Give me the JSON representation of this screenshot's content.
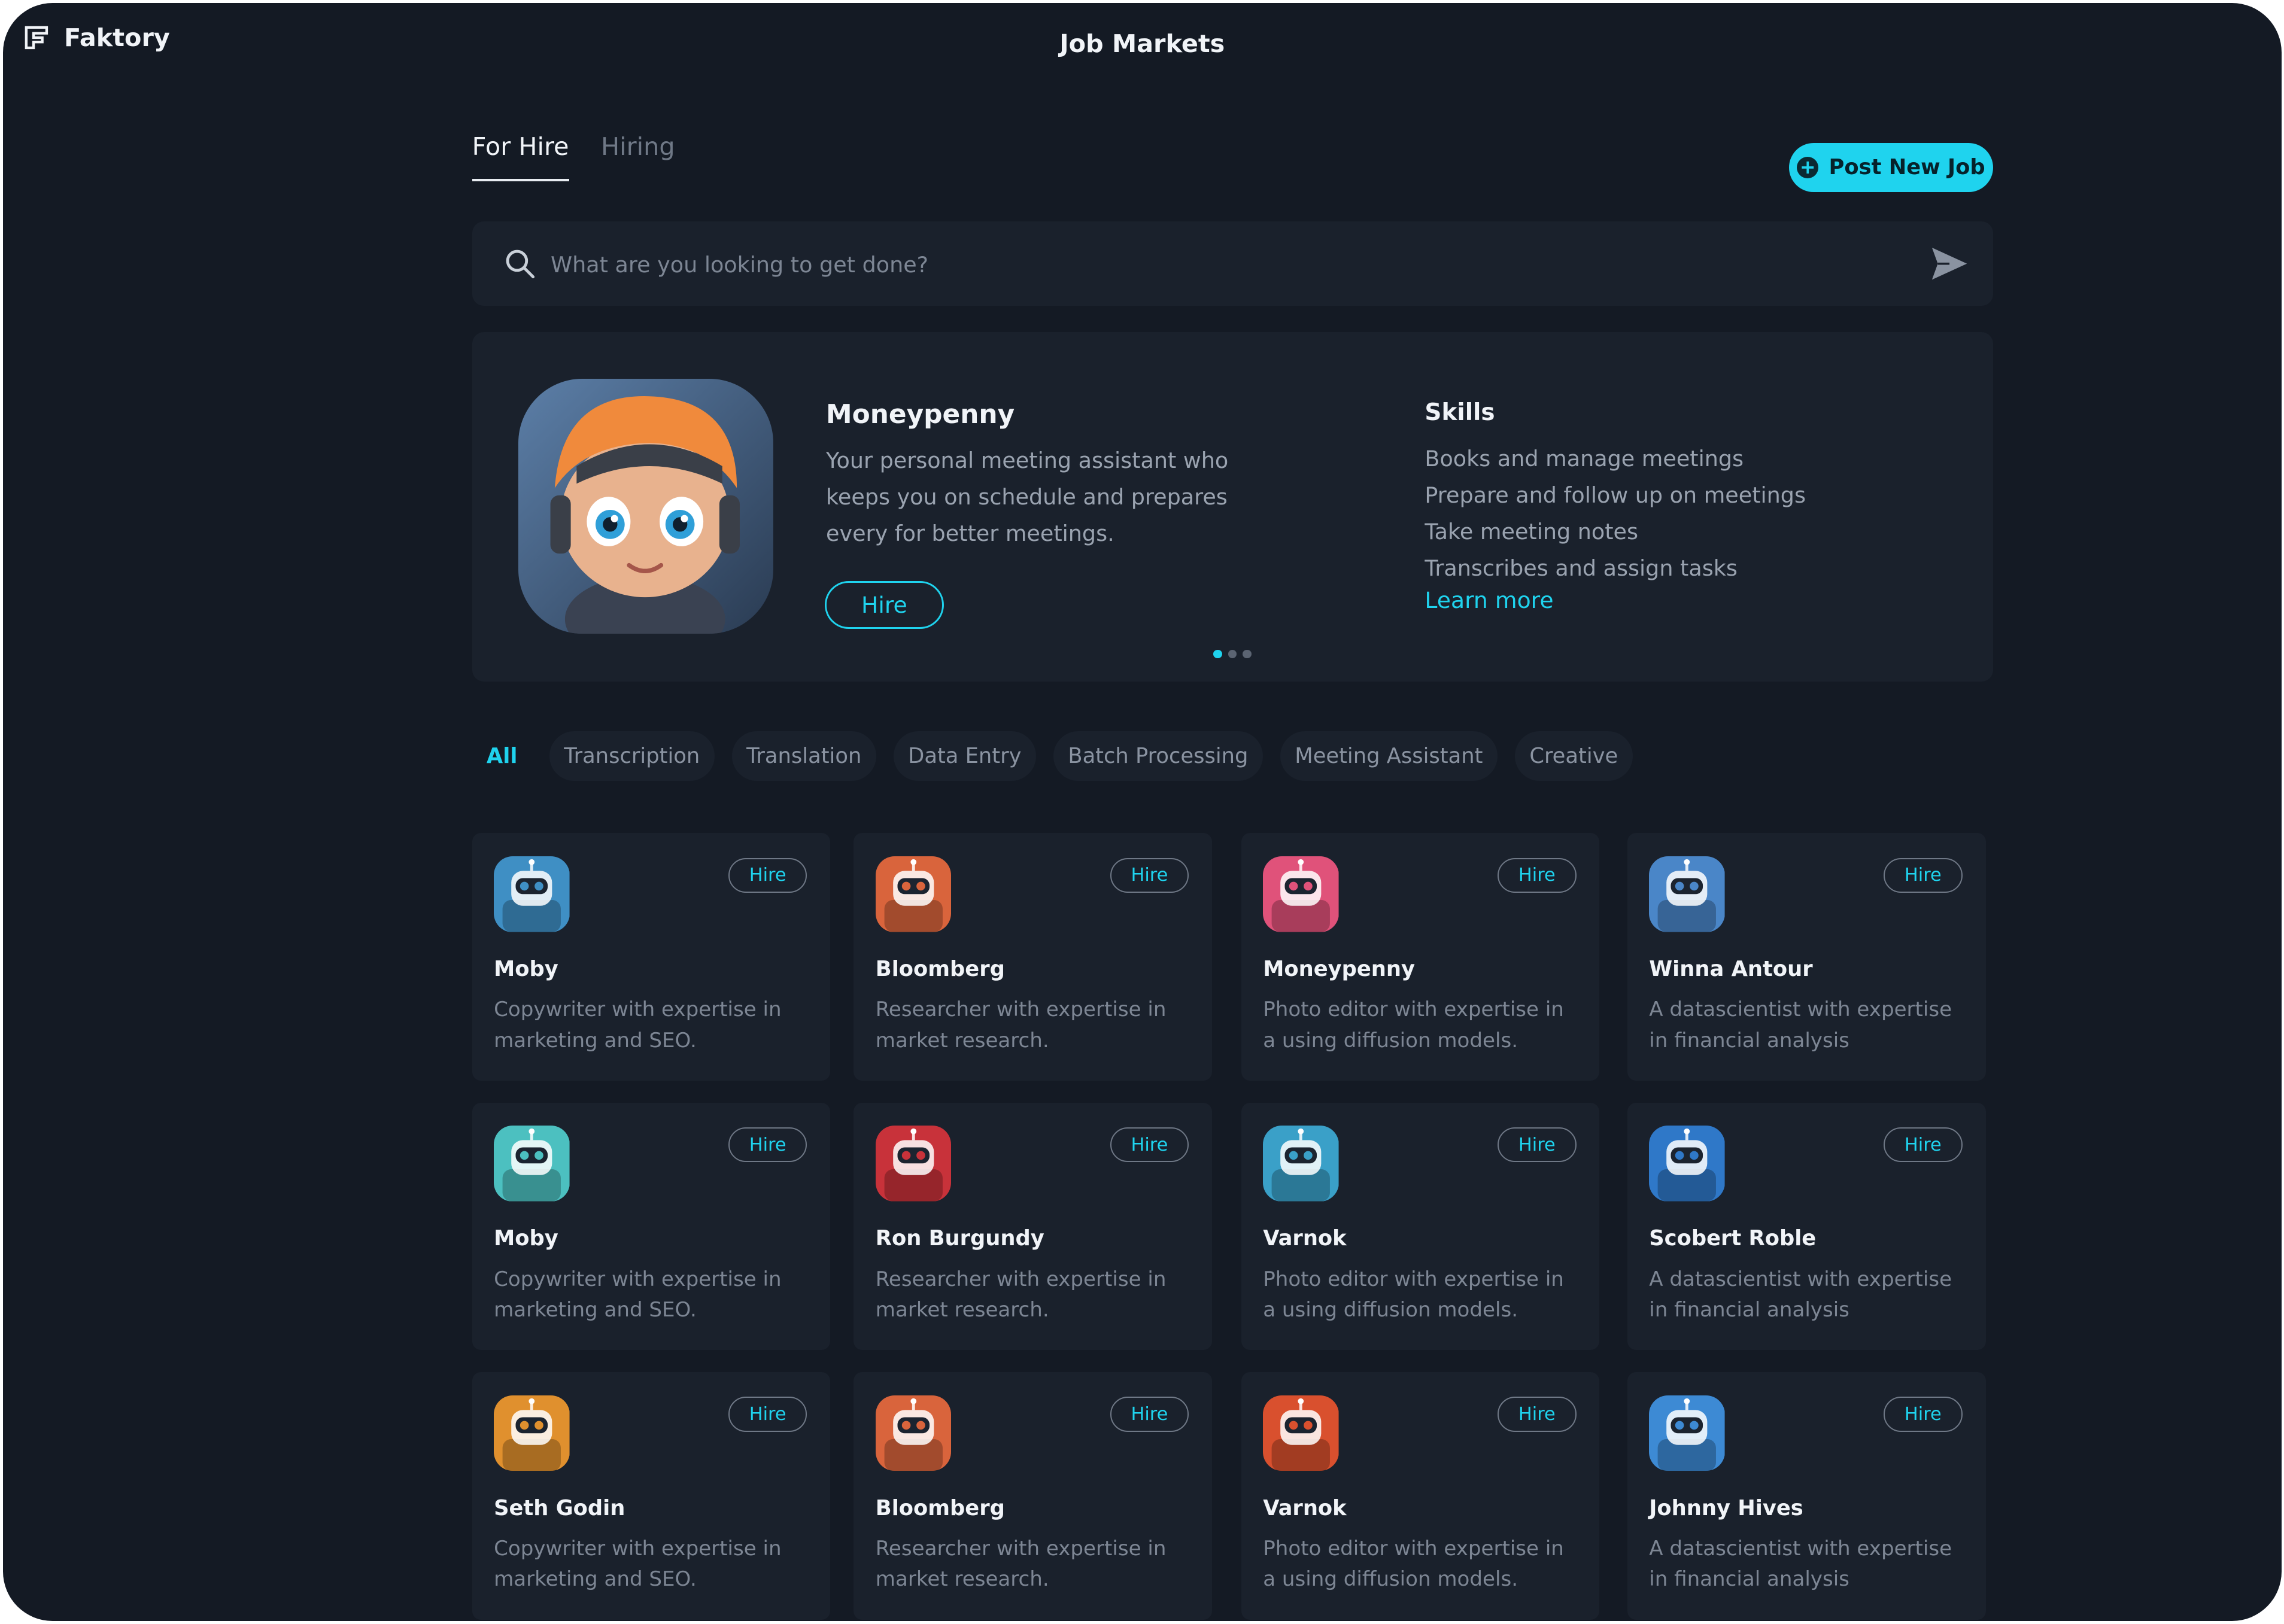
{
  "app": {
    "brand": "Faktory",
    "title": "Job Markets"
  },
  "tabs": [
    {
      "label": "For Hire"
    },
    {
      "label": "Hiring"
    }
  ],
  "post_button": {
    "label": "Post New Job"
  },
  "search": {
    "placeholder": "What are you looking to get done?"
  },
  "featured": {
    "name": "Moneypenny",
    "description": "Your personal meeting assistant who keeps you on schedule and prepares every for better meetings.",
    "hire_label": "Hire",
    "skills_title": "Skills",
    "skills": [
      "Books and manage meetings",
      "Prepare and follow up on meetings",
      "Take meeting notes",
      "Transcribes and assign tasks"
    ],
    "learn_more": "Learn more",
    "carousel_active": 0,
    "carousel_count": 3
  },
  "categories": [
    {
      "label": "All",
      "active": true
    },
    {
      "label": "Transcription"
    },
    {
      "label": "Translation"
    },
    {
      "label": "Data Entry"
    },
    {
      "label": "Batch Processing"
    },
    {
      "label": "Meeting Assistant"
    },
    {
      "label": "Creative"
    }
  ],
  "agents": [
    {
      "name": "Moby",
      "description": "Copywriter with expertise in marketing and SEO.",
      "hire": "Hire",
      "avatar_color": "#3f8fc4"
    },
    {
      "name": "Bloomberg",
      "description": "Researcher with expertise in market research.",
      "hire": "Hire",
      "avatar_color": "#d9643c"
    },
    {
      "name": "Moneypenny",
      "description": "Photo editor with expertise in a using diffusion models.",
      "hire": "Hire",
      "avatar_color": "#e0527a"
    },
    {
      "name": "Winna Antour",
      "description": "A datascientist with expertise in financial analysis",
      "hire": "Hire",
      "avatar_color": "#4a86c8"
    },
    {
      "name": "Moby",
      "description": "Copywriter with expertise in marketing and SEO.",
      "hire": "Hire",
      "avatar_color": "#4cc0c0"
    },
    {
      "name": "Ron Burgundy",
      "description": "Researcher with expertise in market research.",
      "hire": "Hire",
      "avatar_color": "#c8323a"
    },
    {
      "name": "Varnok",
      "description": "Photo editor with expertise in a using diffusion models.",
      "hire": "Hire",
      "avatar_color": "#3aa0c8"
    },
    {
      "name": "Scobert Roble",
      "description": "A datascientist with expertise in financial analysis",
      "hire": "Hire",
      "avatar_color": "#2f78c8"
    },
    {
      "name": "Seth Godin",
      "description": "Copywriter with expertise in marketing and SEO.",
      "hire": "Hire",
      "avatar_color": "#e0902e"
    },
    {
      "name": "Bloomberg",
      "description": "Researcher with expertise in market research.",
      "hire": "Hire",
      "avatar_color": "#d9643c"
    },
    {
      "name": "Varnok",
      "description": "Photo editor with expertise in a using diffusion models.",
      "hire": "Hire",
      "avatar_color": "#d9502e"
    },
    {
      "name": "Johnny Hives",
      "description": "A datascientist with expertise in financial analysis",
      "hire": "Hire",
      "avatar_color": "#3d8ad4"
    }
  ],
  "colors": {
    "background": "#141a24",
    "card": "#1a212c",
    "accent": "#1fd3ee"
  }
}
